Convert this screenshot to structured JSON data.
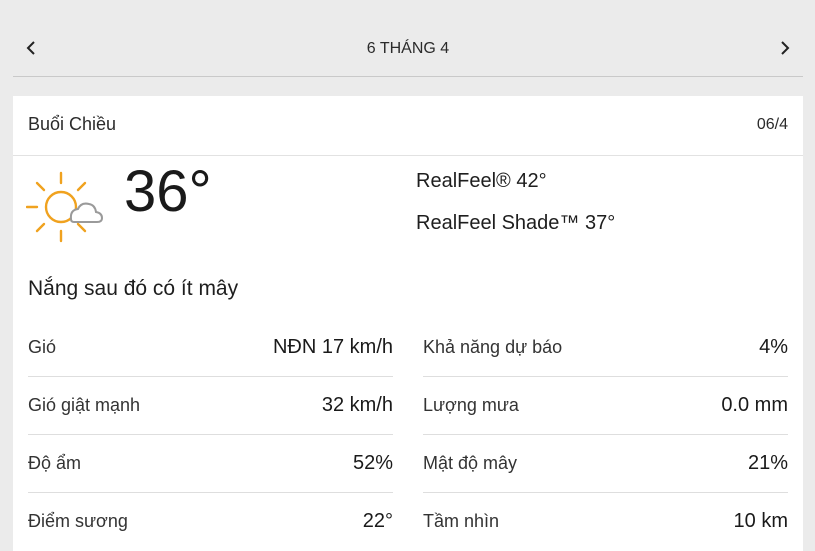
{
  "nav": {
    "title": "6 THÁNG 4",
    "prev_icon": "chevron-left-icon",
    "next_icon": "chevron-right-icon"
  },
  "card": {
    "title": "Buổi Chiều",
    "date": "06/4",
    "icon": "sun-with-cloud-icon",
    "temperature": "36°",
    "realfeel": "RealFeel® 42°",
    "realfeel_shade": "RealFeel Shade™ 37°",
    "phrase": "Nắng sau đó có ít mây"
  },
  "details": {
    "left": [
      {
        "label": "Gió",
        "value": "NĐN 17 km/h"
      },
      {
        "label": "Gió giật mạnh",
        "value": "32 km/h"
      },
      {
        "label": "Độ ẩm",
        "value": "52%"
      },
      {
        "label": "Điểm sương",
        "value": "22°"
      }
    ],
    "right": [
      {
        "label": "Khả năng dự báo",
        "value": "4%"
      },
      {
        "label": "Lượng mưa",
        "value": "0.0 mm"
      },
      {
        "label": "Mật độ mây",
        "value": "21%"
      },
      {
        "label": "Tầm nhìn",
        "value": "10 km"
      }
    ]
  },
  "colors": {
    "sun": "#f0a21f",
    "cloud_stroke": "#9a9a9a",
    "background": "#ebebeb",
    "card": "#ffffff"
  }
}
